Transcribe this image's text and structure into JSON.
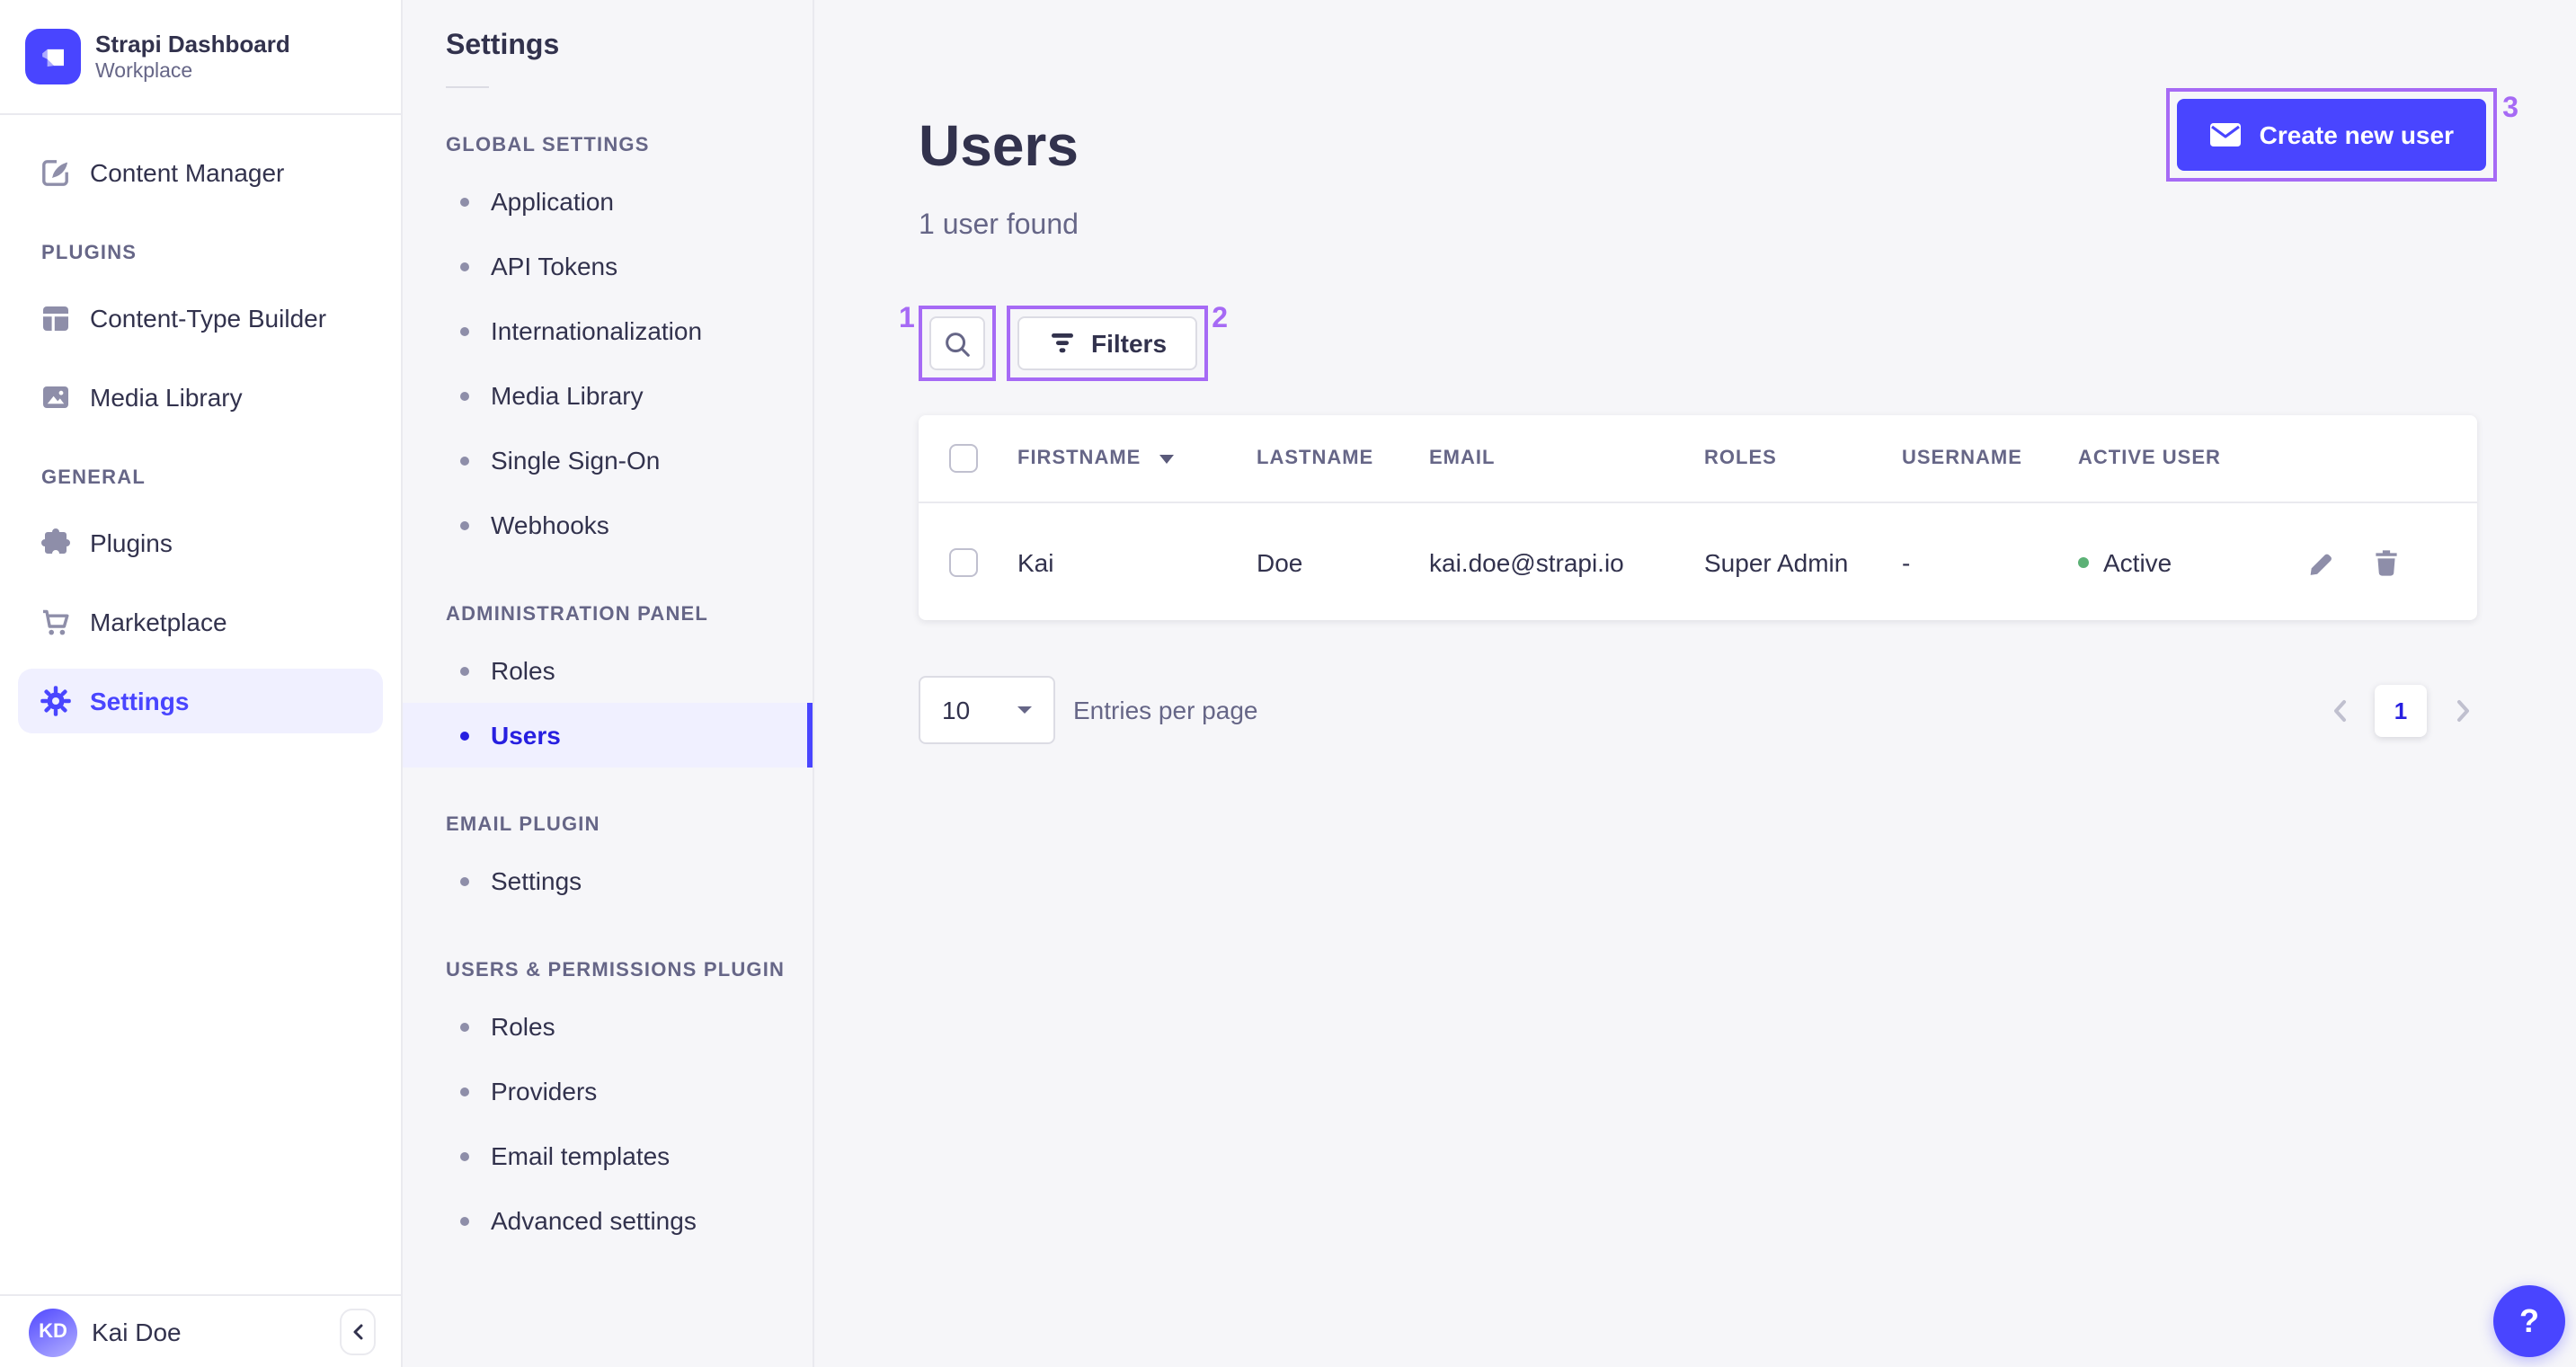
{
  "brand": {
    "title": "Strapi Dashboard",
    "subtitle": "Workplace"
  },
  "main_nav": {
    "content_manager": "Content Manager",
    "sections": [
      {
        "label": "PLUGINS",
        "items": [
          "Content-Type Builder",
          "Media Library"
        ]
      },
      {
        "label": "GENERAL",
        "items": [
          "Plugins",
          "Marketplace",
          "Settings"
        ]
      }
    ],
    "user_initials": "KD",
    "user_name": "Kai Doe"
  },
  "sub_nav": {
    "title": "Settings",
    "sections": [
      {
        "label": "GLOBAL SETTINGS",
        "items": [
          "Application",
          "API Tokens",
          "Internationalization",
          "Media Library",
          "Single Sign-On",
          "Webhooks"
        ]
      },
      {
        "label": "ADMINISTRATION PANEL",
        "items": [
          "Roles",
          "Users"
        ]
      },
      {
        "label": "EMAIL PLUGIN",
        "items": [
          "Settings"
        ]
      },
      {
        "label": "USERS & PERMISSIONS PLUGIN",
        "items": [
          "Roles",
          "Providers",
          "Email templates",
          "Advanced settings"
        ]
      }
    ],
    "active_item": "Users"
  },
  "page": {
    "title": "Users",
    "subtitle": "1 user found",
    "create_button": "Create new user",
    "filters_button": "Filters"
  },
  "table": {
    "headers": [
      "FIRSTNAME",
      "LASTNAME",
      "EMAIL",
      "ROLES",
      "USERNAME",
      "ACTIVE USER"
    ],
    "row": {
      "firstname": "Kai",
      "lastname": "Doe",
      "email": "kai.doe@strapi.io",
      "roles": "Super Admin",
      "username": "-",
      "active_label": "Active"
    }
  },
  "pagination": {
    "page_size": "10",
    "label": "Entries per page",
    "current_page": "1"
  },
  "annotations": {
    "one": "1",
    "two": "2",
    "three": "3"
  },
  "help": {
    "label": "?"
  },
  "icons": {
    "logo": "strapi-logo",
    "content_manager": "pen-icon",
    "content_type_builder": "grid-icon",
    "media_library": "image-icon",
    "plugins": "puzzle-icon",
    "marketplace": "cart-icon",
    "settings": "gear-icon",
    "search": "search-icon",
    "filters": "filter-icon",
    "create": "mail-icon",
    "sort": "caret-down-icon",
    "edit": "pencil-icon",
    "delete": "trash-icon",
    "prev": "chevron-left-icon",
    "next": "chevron-right-icon",
    "collapse": "chevron-left-icon",
    "help": "question-mark-icon"
  },
  "colors": {
    "accent": "#4945ff",
    "accent_dark": "#271fe0",
    "accent_bg": "#f0f0ff",
    "annotation": "#a66af5",
    "status_active": "#5cb176",
    "text_dark": "#32324d",
    "text_mid": "#666687",
    "border": "#eaeaef"
  }
}
